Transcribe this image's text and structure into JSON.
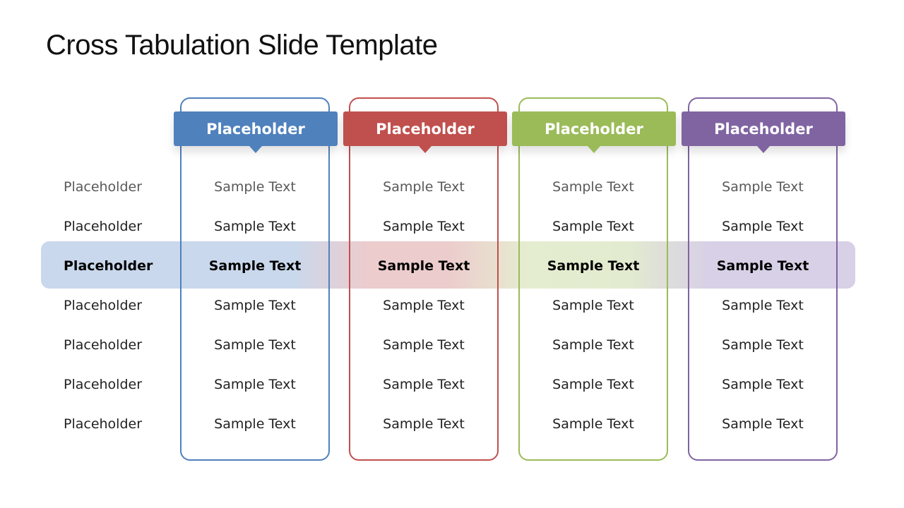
{
  "slide": {
    "title": "Cross Tabulation Slide Template"
  },
  "columns": [
    {
      "header": "Placeholder",
      "color": "#4f81bd",
      "cells": [
        "Sample Text",
        "Sample Text",
        "Sample Text",
        "Sample Text",
        "Sample Text",
        "Sample Text",
        "Sample Text"
      ]
    },
    {
      "header": "Placeholder",
      "color": "#c0504d",
      "cells": [
        "Sample Text",
        "Sample Text",
        "Sample Text",
        "Sample Text",
        "Sample Text",
        "Sample Text",
        "Sample Text"
      ]
    },
    {
      "header": "Placeholder",
      "color": "#9bbb59",
      "cells": [
        "Sample Text",
        "Sample Text",
        "Sample Text",
        "Sample Text",
        "Sample Text",
        "Sample Text",
        "Sample Text"
      ]
    },
    {
      "header": "Placeholder",
      "color": "#8064a2",
      "cells": [
        "Sample Text",
        "Sample Text",
        "Sample Text",
        "Sample Text",
        "Sample Text",
        "Sample Text",
        "Sample Text"
      ]
    }
  ],
  "row_labels": [
    "Placeholder",
    "Placeholder",
    "Placeholder",
    "Placeholder",
    "Placeholder",
    "Placeholder",
    "Placeholder"
  ],
  "highlighted_row": 2
}
